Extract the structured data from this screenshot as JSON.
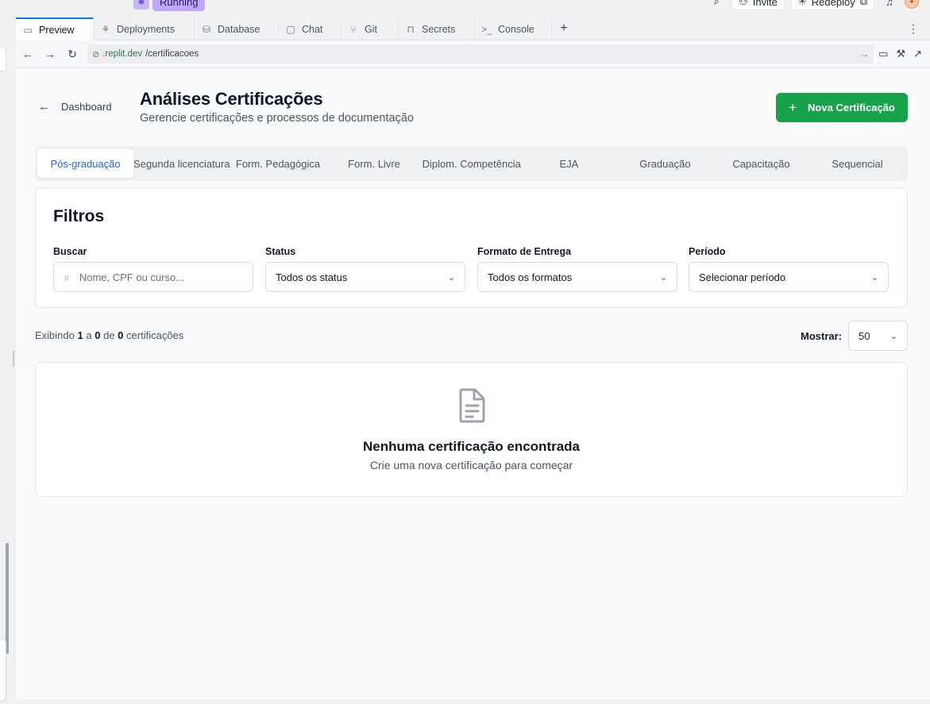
{
  "replit": {
    "run_status": "Running",
    "invite_label": "Invite",
    "redeploy_label": "Redeploy"
  },
  "workspace_tabs": [
    {
      "label": "Preview",
      "icon": "monitor-icon",
      "glyph": "▭"
    },
    {
      "label": "Deployments",
      "icon": "deploy-icon",
      "glyph": "⚘"
    },
    {
      "label": "Database",
      "icon": "database-icon",
      "glyph": "⛁"
    },
    {
      "label": "Chat",
      "icon": "chat-icon",
      "glyph": "▢"
    },
    {
      "label": "Git",
      "icon": "git-icon",
      "glyph": "⑂"
    },
    {
      "label": "Secrets",
      "icon": "lock-icon",
      "glyph": "🔒"
    },
    {
      "label": "Console",
      "icon": "terminal-icon",
      "glyph": ">_"
    }
  ],
  "browser": {
    "url_domain": ".replit.dev",
    "url_path": "/certificacoes"
  },
  "page": {
    "back_label": "Dashboard",
    "title": "Análises Certificações",
    "subtitle": "Gerencie certificações e processos de documentação",
    "new_button_label": "Nova Certificação"
  },
  "category_tabs": [
    "Pós-graduação",
    "Segunda licenciatura",
    "Form. Pedagógica",
    "Form. Livre",
    "Diplom. Competência",
    "EJA",
    "Graduação",
    "Capacitação",
    "Sequencial"
  ],
  "filters": {
    "title": "Filtros",
    "search": {
      "label": "Buscar",
      "placeholder": "Nome, CPF ou curso..."
    },
    "status": {
      "label": "Status",
      "value": "Todos os status"
    },
    "delivery": {
      "label": "Formato de Entrega",
      "value": "Todos os formatos"
    },
    "period": {
      "label": "Período",
      "value": "Selecionar período"
    }
  },
  "results": {
    "prefix": "Exibindo",
    "from": "1",
    "sep_a": "a",
    "to": "0",
    "sep_de": "de",
    "total": "0",
    "suffix": "certificações",
    "show_label": "Mostrar:",
    "page_size": "50"
  },
  "empty_state": {
    "title": "Nenhuma certificação encontrada",
    "subtitle": "Crie uma nova certificação para começar"
  },
  "colors": {
    "primary_green": "#16a34a",
    "active_tab_blue": "#2563eb",
    "replit_accent": "#0079f2"
  }
}
